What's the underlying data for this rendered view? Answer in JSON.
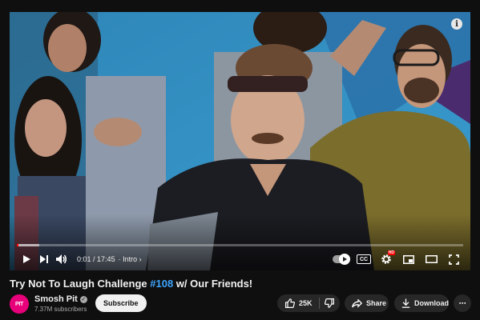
{
  "player": {
    "progress_fraction": 0.0009,
    "buffered_fraction": 0.05,
    "current_time": "0:01",
    "duration": "17:45",
    "time_separator": " / ",
    "chapter": "Intro",
    "chapter_chevron": "›",
    "info_icon_glyph": "i",
    "cc_label": "CC",
    "hd_badge": "HD",
    "colors": {
      "progress": "#ff0000",
      "link": "#3ea6ff"
    }
  },
  "video": {
    "title_prefix": "Try Not To Laugh Challenge ",
    "title_hashtag": "#108",
    "title_suffix": " w/ Our Friends!"
  },
  "channel": {
    "avatar_text": "PIT",
    "name": "Smosh Pit",
    "verified_glyph": "✓",
    "subscribers": "7.37M subscribers",
    "subscribe_label": "Subscribe"
  },
  "actions": {
    "like_count": "25K",
    "share_label": "Share",
    "download_label": "Download",
    "more_glyph": "⋯"
  },
  "icons": [
    "play-icon",
    "next-icon",
    "volume-icon",
    "autoplay-icon",
    "cc-icon",
    "settings-icon",
    "miniplayer-icon",
    "theater-icon",
    "fullscreen-icon",
    "thumbs-up-icon",
    "thumbs-down-icon",
    "share-icon",
    "download-icon",
    "more-icon",
    "verified-icon",
    "info-icon"
  ]
}
